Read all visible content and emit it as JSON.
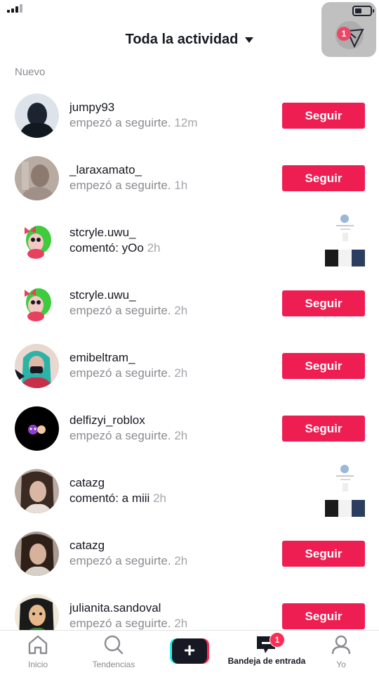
{
  "header": {
    "title": "Toda la actividad"
  },
  "section": {
    "label": "Nuevo"
  },
  "overlay": {
    "badge": "1"
  },
  "follow_label": "Seguir",
  "rows": [
    {
      "username": "jumpy93",
      "activity": "empezó a seguirte.",
      "time": "12m",
      "type": "follow",
      "avatar_color": "#1b2430"
    },
    {
      "username": "_laraxamato_",
      "activity": "empezó a seguirte.",
      "time": "1h",
      "type": "follow",
      "avatar_color": "#9a8a80"
    },
    {
      "username": "stcryle.uwu_",
      "activity": "comentó: yOo",
      "time": "2h",
      "type": "comment",
      "avatar_color": "#3ecb3e"
    },
    {
      "username": "stcryle.uwu_",
      "activity": "empezó a seguirte.",
      "time": "2h",
      "type": "follow",
      "avatar_color": "#3ecb3e"
    },
    {
      "username": "emibeltram_",
      "activity": "empezó a seguirte.",
      "time": "2h",
      "type": "follow",
      "avatar_color": "#2bb3a8"
    },
    {
      "username": "delfizyi_roblox",
      "activity": "empezó a seguirte.",
      "time": "2h",
      "type": "follow",
      "avatar_color": "#000000"
    },
    {
      "username": "catazg",
      "activity": "comentó: a miii",
      "time": "2h",
      "type": "comment",
      "avatar_color": "#7a6a60"
    },
    {
      "username": "catazg",
      "activity": "empezó a seguirte.",
      "time": "2h",
      "type": "follow",
      "avatar_color": "#6a5a50"
    },
    {
      "username": "julianita.sandoval",
      "activity": "empezó a seguirte.",
      "time": "2h",
      "type": "follow",
      "avatar_color": "#3a7a3a"
    }
  ],
  "nav": {
    "home": "Inicio",
    "discover": "Tendencias",
    "inbox": "Bandeja de entrada",
    "inbox_badge": "1",
    "me": "Yo"
  },
  "colors": {
    "accent": "#ee1d52",
    "text": "#161823",
    "muted": "#8a8b91"
  }
}
